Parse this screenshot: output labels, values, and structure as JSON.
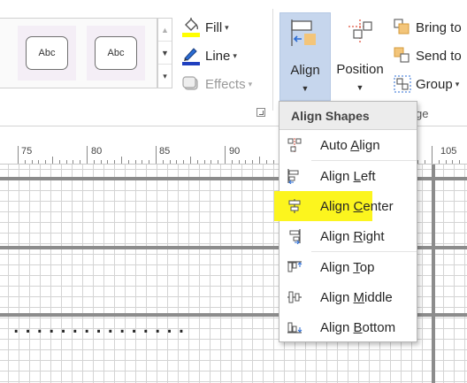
{
  "ribbon": {
    "shape_style_previews": [
      "Abc",
      "Abc"
    ],
    "fill": {
      "label": "Fill",
      "icon": "paint-bucket-icon",
      "underline_color": "#ffff00"
    },
    "line": {
      "label": "Line",
      "icon": "pen-line-icon",
      "underline_color": "#1f3fbf"
    },
    "effects": {
      "label": "Effects",
      "icon": "effects-icon",
      "disabled": true
    },
    "align": {
      "label": "Align",
      "icon": "align-icon",
      "active": true
    },
    "position": {
      "label": "Position",
      "icon": "position-icon"
    },
    "bring_to": {
      "label": "Bring to"
    },
    "send_to": {
      "label": "Send to"
    },
    "group": {
      "label": "Group"
    },
    "arrange_group_label_visible": "ge"
  },
  "ruler": {
    "labels": [
      "75",
      "80",
      "85",
      "90",
      "105"
    ]
  },
  "canvas": {
    "clipped_text": "...............",
    "shape_border_color": "#8c8c8c"
  },
  "align_menu": {
    "header": "Align Shapes",
    "items": [
      {
        "pre": "Auto ",
        "key": "A",
        "post": "lign",
        "icon": "auto-align-icon"
      },
      {
        "pre": "Align ",
        "key": "L",
        "post": "eft",
        "icon": "align-left-icon"
      },
      {
        "pre": "Align ",
        "key": "C",
        "post": "enter",
        "icon": "align-center-icon",
        "highlighted": true,
        "highlight_color": "#fcf51e"
      },
      {
        "pre": "Align ",
        "key": "R",
        "post": "ight",
        "icon": "align-right-icon"
      },
      {
        "pre": "Align ",
        "key": "T",
        "post": "op",
        "icon": "align-top-icon"
      },
      {
        "pre": "Align ",
        "key": "M",
        "post": "iddle",
        "icon": "align-middle-icon"
      },
      {
        "pre": "Align ",
        "key": "B",
        "post": "ottom",
        "icon": "align-bottom-icon"
      }
    ]
  }
}
